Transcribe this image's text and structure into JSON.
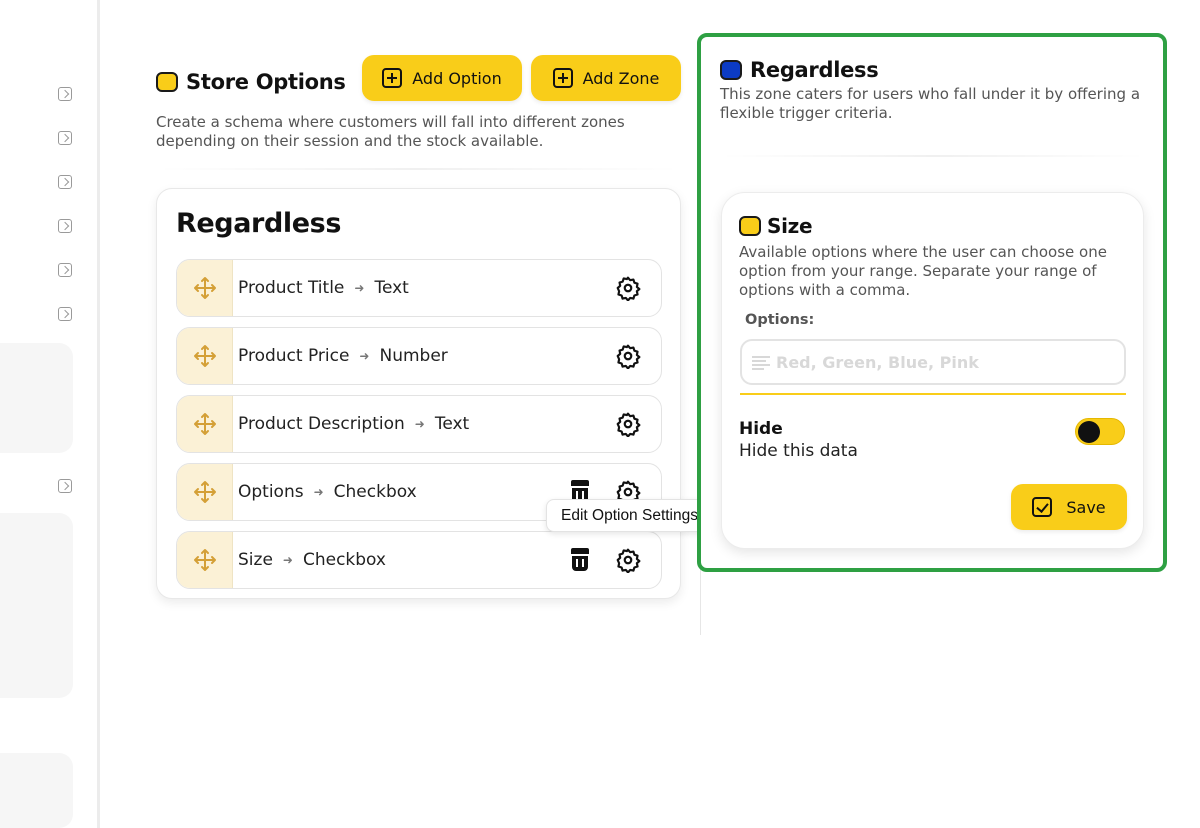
{
  "store": {
    "title": "Store Options",
    "description": "Create a schema where customers will fall into different zones depending on their session and the stock available.",
    "add_option_label": "Add Option",
    "add_zone_label": "Add Zone"
  },
  "zone": {
    "title": "Regardless",
    "rows": [
      {
        "name": "Product Title",
        "type": "Text",
        "deletable": false
      },
      {
        "name": "Product Price",
        "type": "Number",
        "deletable": false
      },
      {
        "name": "Product Description",
        "type": "Text",
        "deletable": false
      },
      {
        "name": "Options",
        "type": "Checkbox",
        "deletable": true
      },
      {
        "name": "Size",
        "type": "Checkbox",
        "deletable": true
      }
    ]
  },
  "tooltip": {
    "text": "Edit Option Settings"
  },
  "panel": {
    "title": "Regardless",
    "description": "This zone caters for users who fall under it by offering a flexible trigger criteria.",
    "option": {
      "title": "Size",
      "description": "Available options where the user can choose one option from your range. Separate your range of options with a comma.",
      "options_label": "Options:",
      "options_placeholder": "Red, Green, Blue, Pink",
      "hide_title": "Hide",
      "hide_description": "Hide this data",
      "hide_enabled": false,
      "save_label": "Save"
    }
  },
  "colors": {
    "accent": "#f9cd19",
    "zone_blue": "#0c3bc4",
    "highlight_border": "#2ea043"
  },
  "icons": {
    "drag": "drag-move-icon",
    "settings": "gear-icon",
    "delete": "trash-icon",
    "add": "plus-square-icon",
    "save": "check-square-icon"
  }
}
